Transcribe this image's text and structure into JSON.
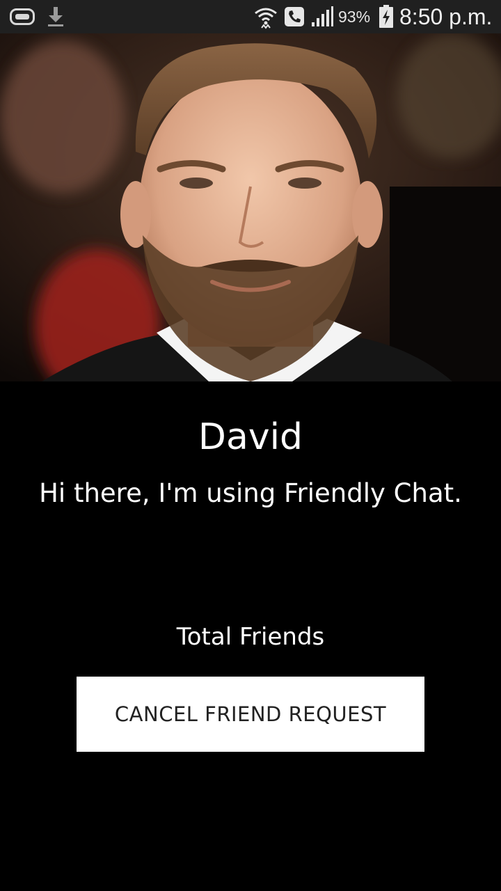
{
  "status_bar": {
    "left_icons": [
      "gamepad-icon",
      "download-icon"
    ],
    "right_icons": [
      "wifi-icon",
      "phone-icon",
      "signal-icon",
      "battery-charging-icon"
    ],
    "battery_percent": "93%",
    "time": "8:50 p.m."
  },
  "profile": {
    "photo": "profile-photo",
    "name": "David",
    "status": "Hi there, I'm using Friendly Chat.",
    "friends_label": "Total Friends"
  },
  "actions": {
    "cancel_request_label": "CANCEL FRIEND REQUEST"
  },
  "colors": {
    "background": "#000000",
    "status_bar": "#202020",
    "text": "#ffffff",
    "button_bg": "#ffffff",
    "button_text": "#222222"
  }
}
